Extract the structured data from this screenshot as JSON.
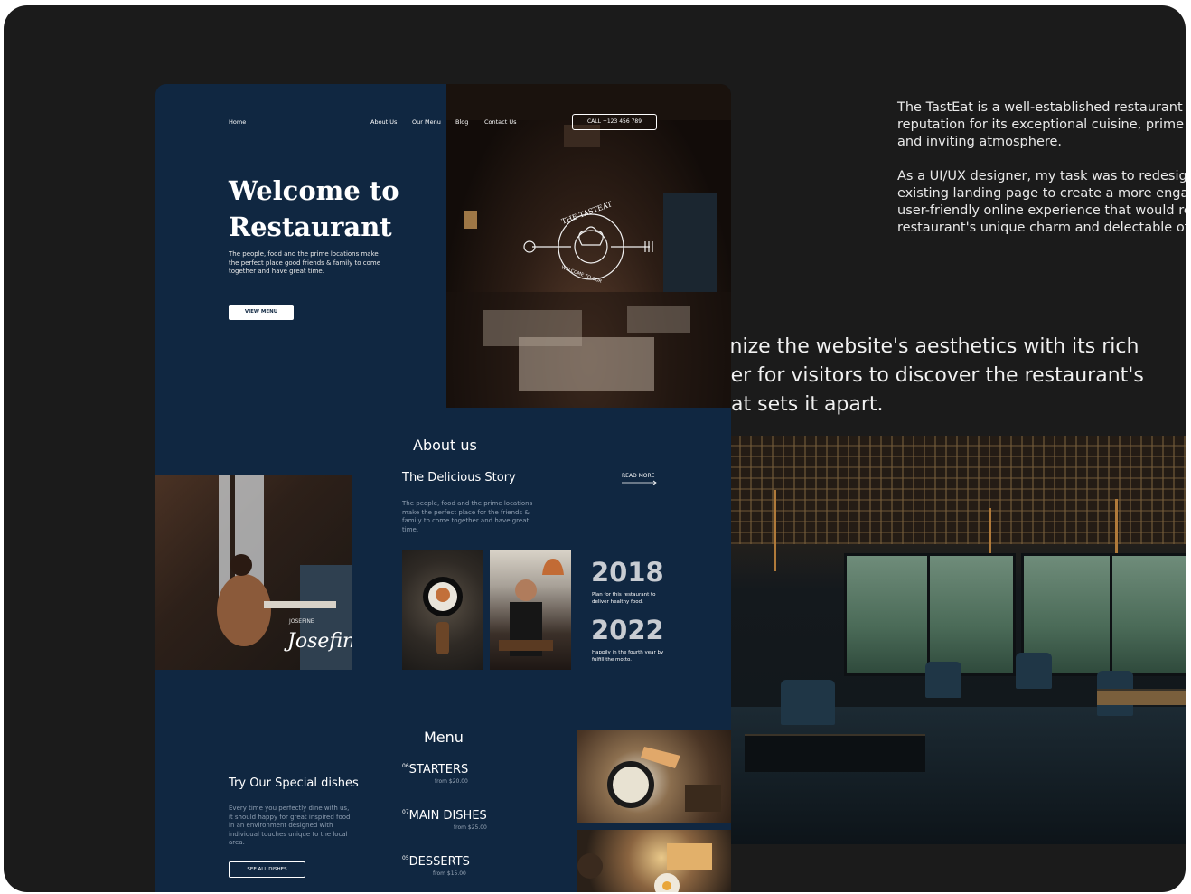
{
  "case_study": {
    "paragraph_1_lines": [
      "The TastEat is a well-established restaurant w",
      "reputation for its exceptional cuisine, prime l",
      "and inviting atmosphere."
    ],
    "paragraph_2_lines": [
      "As a UI/UX designer, my task was to redesign",
      "existing landing page to create a more engag",
      "user-friendly online experience that would re",
      "restaurant's unique charm and delectable off"
    ],
    "large_text_lines": [
      "rmonize the website's aesthetics with its rich",
      "easier for visitors to discover the restaurant's",
      "l what sets it apart."
    ]
  },
  "nav": {
    "home": "Home",
    "about": "About Us",
    "menu": "Our Menu",
    "blog": "Blog",
    "contact": "Contact Us",
    "call": "CALL +123 456 789"
  },
  "hero": {
    "title_line_1": "Welcome to",
    "title_line_2": "Restaurant",
    "subtitle": "The people, food and the prime locations make the perfect place good friends & family to come together and have great time.",
    "button": "VIEW MENU",
    "logo_top": "THE TASTEAT",
    "logo_bottom": "WELCOME TO OUR"
  },
  "about": {
    "heading": "About us",
    "story_title": "The Delicious Story",
    "read_more": "READ MORE",
    "story_text": "The people, food and the prime locations make the perfect place for the friends & family to come together and have great time.",
    "signature_name": "JOSEFINE",
    "signature": "Josefine",
    "milestones": [
      {
        "year": "2018",
        "caption": "Plan for this restaurant to deliver healthy food."
      },
      {
        "year": "2022",
        "caption": "Happily in the fourth year by fulfill the motto."
      }
    ]
  },
  "menu": {
    "heading": "Menu",
    "special_title": "Try Our Special dishes",
    "special_text": "Every time you perfectly dine with us, it should happy for great inspired food in an environment designed with individual touches unique to the local area.",
    "see_all": "SEE ALL DISHES",
    "items": [
      {
        "num": "06",
        "name": "STARTERS",
        "price": "from $20.00"
      },
      {
        "num": "07",
        "name": "MAIN DISHES",
        "price": "from $25.00"
      },
      {
        "num": "05",
        "name": "DESSERTS",
        "price": "from $15.00"
      }
    ]
  },
  "colors": {
    "page_bg": "#1b1b1b",
    "landing_bg": "#102741",
    "text_white": "#ffffff",
    "muted_text": "#8f9fb2"
  }
}
